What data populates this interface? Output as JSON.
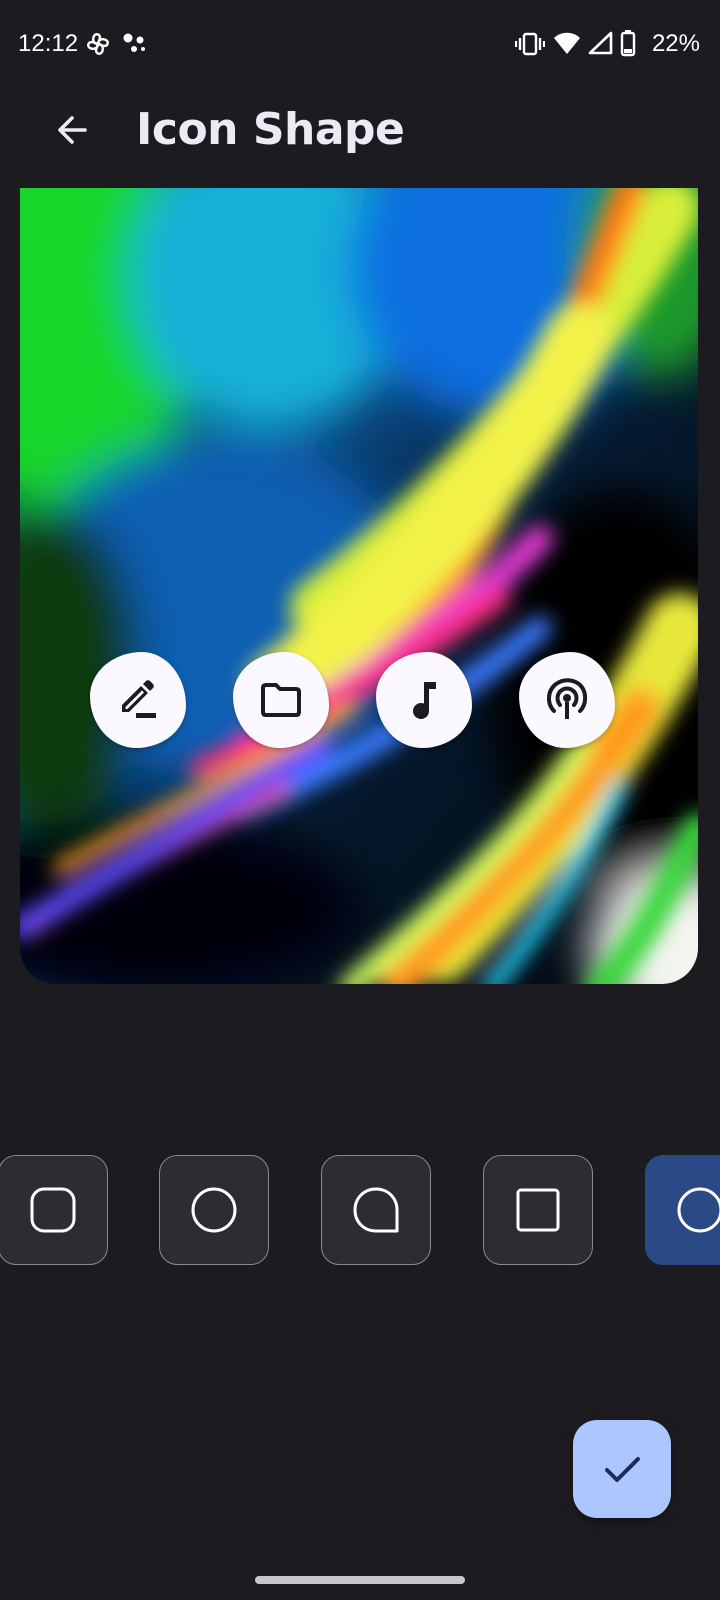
{
  "status_bar": {
    "time": "12:12",
    "battery": "22%",
    "icons": [
      "pinwheel-icon",
      "assistant-dots-icon",
      "vibrate-icon",
      "wifi-icon",
      "cell-signal-icon",
      "battery-icon"
    ]
  },
  "header": {
    "title": "Icon Shape",
    "back_icon": "arrow-back-icon"
  },
  "preview": {
    "app_icons": [
      {
        "name": "edit-icon"
      },
      {
        "name": "folder-icon"
      },
      {
        "name": "music-note-icon"
      },
      {
        "name": "podcast-icon"
      }
    ]
  },
  "shape_options": [
    {
      "shape": "rounded-square",
      "selected": false
    },
    {
      "shape": "circle",
      "selected": false
    },
    {
      "shape": "teardrop",
      "selected": false
    },
    {
      "shape": "square",
      "selected": false
    },
    {
      "shape": "circle",
      "selected": true
    }
  ],
  "fab": {
    "icon": "check-icon"
  },
  "colors": {
    "background": "#1c1b20",
    "option_background": "#2d2c31",
    "option_selected": "#2b4a85",
    "fab": "#aec6ff",
    "fab_icon": "#1a2e55"
  }
}
